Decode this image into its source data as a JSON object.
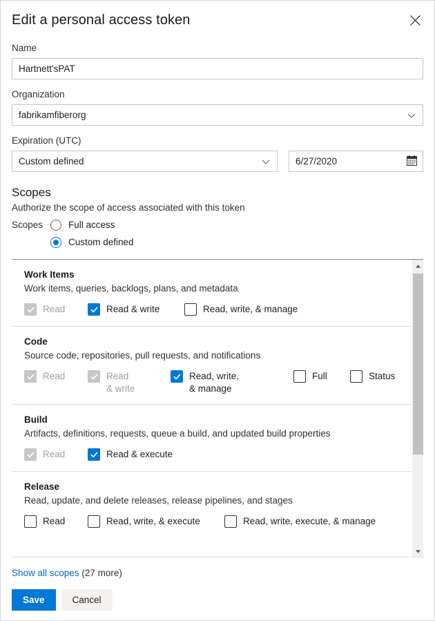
{
  "dialog": {
    "title": "Edit a personal access token",
    "close_icon": "close-icon"
  },
  "form": {
    "name": {
      "label": "Name",
      "value": "Hartnett'sPAT"
    },
    "organization": {
      "label": "Organization",
      "value": "fabrikamfiberorg"
    },
    "expiration": {
      "label": "Expiration (UTC)",
      "preset_value": "Custom defined",
      "date_value": "6/27/2020",
      "calendar_icon": "calendar-icon"
    }
  },
  "scopes": {
    "heading": "Scopes",
    "subtitle": "Authorize the scope of access associated with this token",
    "radio_label": "Scopes",
    "options": [
      {
        "label": "Full access",
        "selected": false
      },
      {
        "label": "Custom defined",
        "selected": true
      }
    ],
    "groups": [
      {
        "title": "Work Items",
        "description": "Work items, queries, backlogs, plans, and metadata",
        "checkboxes": [
          {
            "label": "Read",
            "checked": true,
            "disabled": true
          },
          {
            "label": "Read & write",
            "checked": true,
            "disabled": false
          },
          {
            "label": "Read, write, & manage",
            "checked": false,
            "disabled": false
          }
        ]
      },
      {
        "title": "Code",
        "description": "Source code, repositories, pull requests, and notifications",
        "checkboxes": [
          {
            "label": "Read",
            "checked": true,
            "disabled": true
          },
          {
            "label": "Read & write",
            "checked": true,
            "disabled": true
          },
          {
            "label": "Read, write, & manage",
            "checked": true,
            "disabled": false
          },
          {
            "label": "Full",
            "checked": false,
            "disabled": false
          },
          {
            "label": "Status",
            "checked": false,
            "disabled": false
          }
        ]
      },
      {
        "title": "Build",
        "description": "Artifacts, definitions, requests, queue a build, and updated build properties",
        "checkboxes": [
          {
            "label": "Read",
            "checked": true,
            "disabled": true
          },
          {
            "label": "Read & execute",
            "checked": true,
            "disabled": false
          }
        ]
      },
      {
        "title": "Release",
        "description": "Read, update, and delete releases, release pipelines, and stages",
        "checkboxes": [
          {
            "label": "Read",
            "checked": false,
            "disabled": false
          },
          {
            "label": "Read, write, & execute",
            "checked": false,
            "disabled": false
          },
          {
            "label": "Read, write, execute, & manage",
            "checked": false,
            "disabled": false
          }
        ]
      }
    ],
    "show_all_link": "Show all scopes",
    "show_all_count": "(27 more)"
  },
  "footer": {
    "save_label": "Save",
    "cancel_label": "Cancel"
  },
  "colors": {
    "accent": "#0078d4",
    "link": "#0066b8",
    "disabled": "#c8c6c4",
    "border": "#c8c6c4"
  }
}
